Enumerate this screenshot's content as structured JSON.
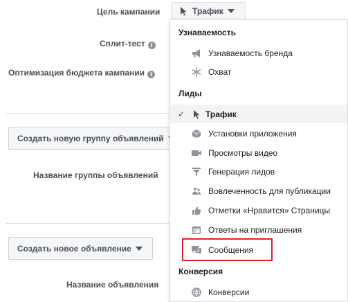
{
  "form": {
    "campaign_objective_label": "Цель кампании",
    "objective_value": "Трафик",
    "split_test_label": "Сплит-тест",
    "budget_optimization_label": "Оптимизация бюджета кампании",
    "create_adset_button": "Создать новую группу объявлений",
    "adset_name_label": "Название группы объявлений",
    "create_ad_button": "Создать новое объявление",
    "ad_name_label": "Название объявления"
  },
  "menu": {
    "sections": {
      "awareness": "Узнаваемость",
      "leads": "Лиды",
      "conversion": "Конверсия"
    },
    "items": [
      {
        "label": "Узнаваемость бренда",
        "icon": "megaphone-icon"
      },
      {
        "label": "Охват",
        "icon": "snowflake-icon"
      },
      {
        "label": "Трафик",
        "icon": "cursor-icon",
        "selected": true
      },
      {
        "label": "Установки приложения",
        "icon": "box-icon"
      },
      {
        "label": "Просмотры видео",
        "icon": "video-camera-icon"
      },
      {
        "label": "Генерация лидов",
        "icon": "funnel-icon"
      },
      {
        "label": "Вовлеченность для публикации",
        "icon": "people-icon"
      },
      {
        "label": "Отметки «Нравится» Страницы",
        "icon": "thumbs-up-icon"
      },
      {
        "label": "Ответы на приглашения",
        "icon": "calendar-icon"
      },
      {
        "label": "Сообщения",
        "icon": "chat-bubble-icon"
      },
      {
        "label": "Конверсии",
        "icon": "globe-icon"
      }
    ],
    "check_mark": "✓"
  },
  "colors": {
    "highlight_border": "#e0202a",
    "icon_gray": "#8d949e"
  }
}
